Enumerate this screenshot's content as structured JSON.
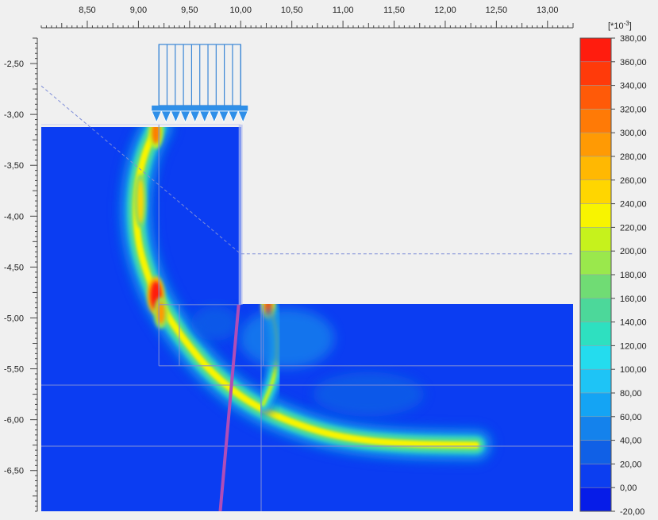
{
  "chart_data": {
    "type": "heatmap",
    "title": "",
    "xlabel": "",
    "ylabel": "",
    "xlim": [
      8.05,
      13.25
    ],
    "ylim": [
      -6.9,
      -2.25
    ],
    "x_ticks": [
      "8,50",
      "9,00",
      "9,50",
      "10,00",
      "10,50",
      "11,00",
      "11,50",
      "12,00",
      "12,50",
      "13,00"
    ],
    "x_tick_values": [
      8.5,
      9.0,
      9.5,
      10.0,
      10.5,
      11.0,
      11.5,
      12.0,
      12.5,
      13.0
    ],
    "y_ticks": [
      "-2,50",
      "-3,00",
      "-3,50",
      "-4,00",
      "-4,50",
      "-5,00",
      "-5,50",
      "-6,00",
      "-6,50"
    ],
    "y_tick_values": [
      -2.5,
      -3.0,
      -3.5,
      -4.0,
      -4.5,
      -5.0,
      -5.5,
      -6.0,
      -6.5
    ],
    "colorbar": {
      "unit_label": "[*10",
      "unit_exponent": "-3",
      "unit_suffix": "]",
      "labels": [
        "380,00",
        "360,00",
        "340,00",
        "320,00",
        "300,00",
        "280,00",
        "260,00",
        "240,00",
        "220,00",
        "200,00",
        "180,00",
        "160,00",
        "140,00",
        "120,00",
        "100,00",
        "80,00",
        "60,00",
        "40,00",
        "20,00",
        "0,00",
        "-20,00"
      ],
      "values": [
        380,
        360,
        340,
        320,
        300,
        280,
        260,
        240,
        220,
        200,
        180,
        160,
        140,
        120,
        100,
        80,
        60,
        40,
        20,
        0,
        -20
      ],
      "colors": [
        "#ff1c0e",
        "#ff3a0a",
        "#ff5a08",
        "#ff7a06",
        "#ff9a04",
        "#ffb802",
        "#ffd600",
        "#f8f400",
        "#c6f21c",
        "#9ae84c",
        "#70dc74",
        "#4cd89a",
        "#2ee0c0",
        "#24dcee",
        "#1ec4f6",
        "#14a4f4",
        "#1482ec",
        "#1060e6",
        "#0c3ef0",
        "#061ce8"
      ]
    },
    "background_value": 0,
    "load": {
      "type": "distributed",
      "x_range": [
        9.2,
        10.0
      ],
      "y": -3.1
    },
    "bands": [
      {
        "name": "slip-arc",
        "peak_value": 380,
        "path": [
          [
            9.18,
            -3.12
          ],
          [
            9.05,
            -3.4
          ],
          [
            8.97,
            -3.8
          ],
          [
            8.99,
            -4.25
          ],
          [
            9.1,
            -4.62
          ],
          [
            9.22,
            -4.88
          ],
          [
            9.42,
            -5.18
          ],
          [
            9.72,
            -5.55
          ],
          [
            10.1,
            -5.85
          ],
          [
            10.55,
            -6.05
          ],
          [
            11.0,
            -6.18
          ],
          [
            11.6,
            -6.24
          ],
          [
            12.3,
            -6.25
          ]
        ]
      },
      {
        "name": "toe-band",
        "peak_value": 330,
        "path": [
          [
            10.25,
            -4.82
          ],
          [
            10.34,
            -5.05
          ],
          [
            10.36,
            -5.3
          ],
          [
            10.33,
            -5.6
          ],
          [
            10.22,
            -5.85
          ]
        ]
      }
    ]
  }
}
